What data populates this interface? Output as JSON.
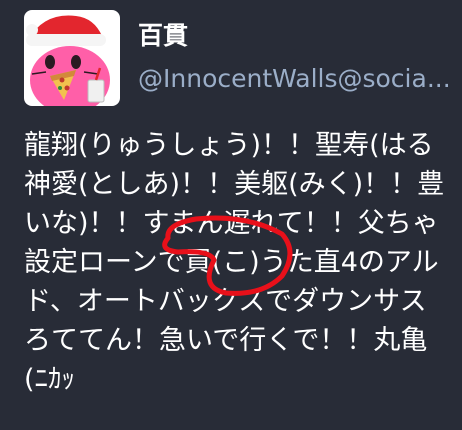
{
  "post": {
    "display_name": "百貫",
    "account": "@InnocentWalls@socia...",
    "content_lines": [
      "龍翔(りゅうしょう)！！聖寿(はる",
      "神愛(としあ)！！美躯(みく)！！豊",
      "いな)！！すまん遅れて！！父ちゃ",
      "設定ローンで買(こ)うた直4のアル",
      "ド、オートバックスでダウンサス",
      "ろててん！急いで行くで！！丸亀",
      "(ﾆｶｯ"
    ]
  },
  "icons": {
    "avatar": "santa-hat-cat-eating-pizza-avatar-icon",
    "annotation": "red-hand-drawn-circle-annotation"
  },
  "colors": {
    "background": "#282c37",
    "text": "#ffffff",
    "secondary_text": "#9baec8",
    "annotation": "#e8101a",
    "avatar_background": "#ffffff",
    "avatar_character": "#ff5fa8"
  }
}
